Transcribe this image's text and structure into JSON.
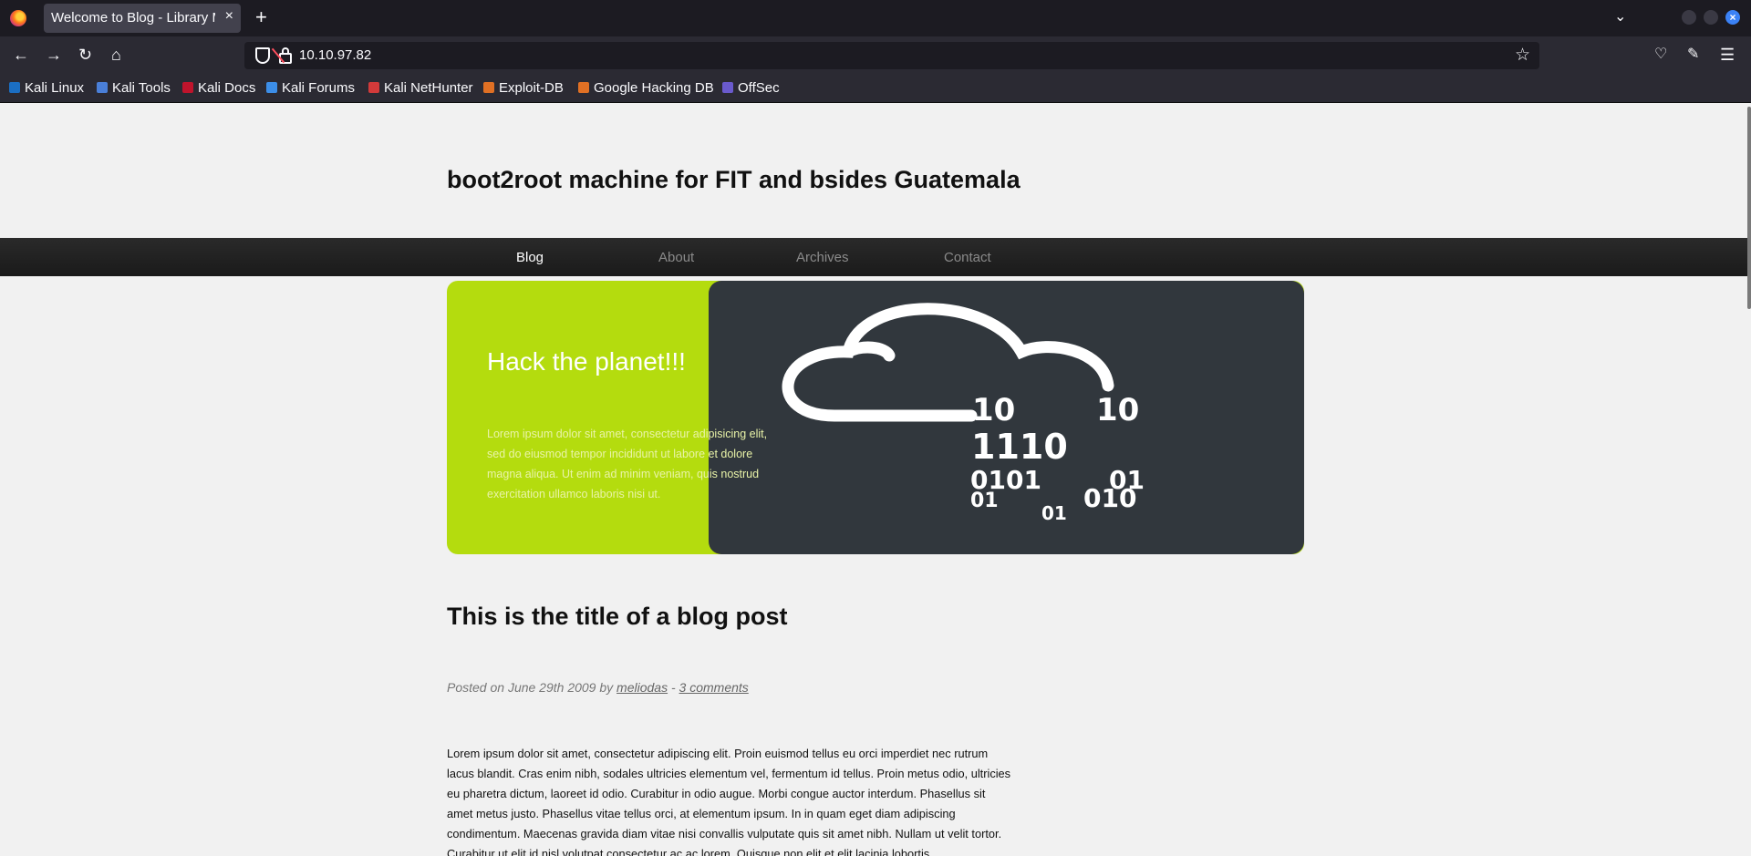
{
  "browser": {
    "tab_title": "Welcome to Blog - Library M",
    "tab_close": "×",
    "new_tab": "+",
    "url": "10.10.97.82",
    "bookmarks": [
      {
        "label": "Kali Linux",
        "color": "#1b6ec2"
      },
      {
        "label": "Kali Tools",
        "color": "#4a7fd8"
      },
      {
        "label": "Kali Docs",
        "color": "#c0142c"
      },
      {
        "label": "Kali Forums",
        "color": "#3c8ee8"
      },
      {
        "label": "Kali NetHunter",
        "color": "#d23a3a"
      },
      {
        "label": "Exploit-DB",
        "color": "#e07024"
      },
      {
        "label": "Google Hacking DB",
        "color": "#e07024"
      },
      {
        "label": "OffSec",
        "color": "#6a5acd"
      }
    ]
  },
  "site": {
    "title": "boot2root machine for FIT and bsides Guatemala",
    "menu": [
      "Blog",
      "About",
      "Archives",
      "Contact"
    ],
    "banner": {
      "heading": "Hack the planet!!!",
      "text": "Lorem ipsum dolor sit amet, consectetur adipisicing elit, sed do eiusmod tempor incididunt ut labore et dolore magna aliqua. Ut enim ad minim veniam, quis nostrud exercitation ullamco laboris nisi ut.",
      "binary": [
        "10",
        "10",
        "1110",
        "0101",
        "01",
        "01",
        "010",
        "01"
      ]
    },
    "post": {
      "title": "This is the title of a blog post",
      "meta_prefix": "Posted on June 29th 2009 by ",
      "author": "meliodas",
      "meta_sep": " - ",
      "comments": "3 comments",
      "body": "Lorem ipsum dolor sit amet, consectetur adipiscing elit. Proin euismod tellus eu orci imperdiet nec rutrum lacus blandit. Cras enim nibh, sodales ultricies elementum vel, fermentum id tellus. Proin metus odio, ultricies eu pharetra dictum, laoreet id odio. Curabitur in odio augue. Morbi congue auctor interdum. Phasellus sit amet metus justo. Phasellus vitae tellus orci, at elementum ipsum. In in quam eget diam adipiscing condimentum. Maecenas gravida diam vitae nisi convallis vulputate quis sit amet nibh. Nullam ut velit tortor. Curabitur ut elit id nisl volutpat consectetur ac ac lorem. Quisque non elit et elit lacinia lobortis"
    }
  }
}
